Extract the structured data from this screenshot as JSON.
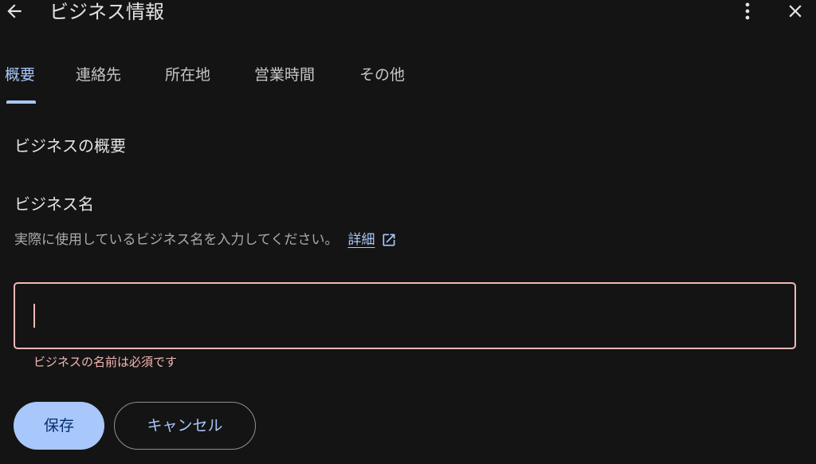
{
  "header": {
    "title": "ビジネス情報",
    "back_icon": "arrow-back-icon",
    "more_icon": "more-vert-icon",
    "close_icon": "close-icon"
  },
  "tabs": [
    {
      "label": "概要",
      "active": true
    },
    {
      "label": "連絡先",
      "active": false
    },
    {
      "label": "所在地",
      "active": false
    },
    {
      "label": "営業時間",
      "active": false
    },
    {
      "label": "その他",
      "active": false
    }
  ],
  "section": {
    "title": "ビジネスの概要"
  },
  "business_name_field": {
    "title": "ビジネス名",
    "help_text": "実際に使用しているビジネス名を入力してください。",
    "learn_more_label": "詳細",
    "learn_more_icon": "open-in-new-icon",
    "value": "",
    "error_text": "ビジネスの名前は必須です"
  },
  "actions": {
    "save_label": "保存",
    "cancel_label": "キャンセル"
  },
  "colors": {
    "background": "#141414",
    "accent": "#a8c7fa",
    "error": "#f2b8b5",
    "text_primary": "#e3e3e3",
    "text_secondary": "#a8abad"
  }
}
